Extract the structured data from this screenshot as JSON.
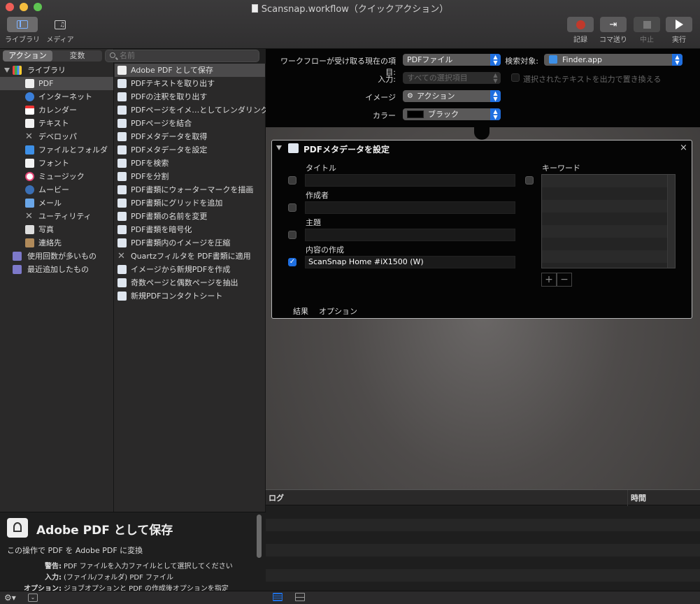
{
  "window": {
    "title": "Scansnap.workflow（クイックアクション）"
  },
  "toolbar": {
    "library_label": "ライブラリ",
    "media_label": "メディア",
    "record_label": "記録",
    "step_label": "コマ送り",
    "stop_label": "中止",
    "run_label": "実行"
  },
  "segments": {
    "actions": "アクション",
    "variables": "変数"
  },
  "search": {
    "placeholder": "名前"
  },
  "library": {
    "root": "ライブラリ",
    "items": [
      {
        "label": "PDF",
        "selected": true
      },
      {
        "label": "インターネット"
      },
      {
        "label": "カレンダー"
      },
      {
        "label": "テキスト"
      },
      {
        "label": "デベロッパ"
      },
      {
        "label": "ファイルとフォルダ"
      },
      {
        "label": "フォント"
      },
      {
        "label": "ミュージック"
      },
      {
        "label": "ムービー"
      },
      {
        "label": "メール"
      },
      {
        "label": "ユーティリティ"
      },
      {
        "label": "写真"
      },
      {
        "label": "連絡先"
      }
    ],
    "smart": [
      "使用回数が多いもの",
      "最近追加したもの"
    ]
  },
  "actions": [
    "Adobe PDF として保存",
    "PDFテキストを取り出す",
    "PDFの注釈を取り出す",
    "PDFページをイメ…としてレンダリング",
    "PDFページを結合",
    "PDFメタデータを取得",
    "PDFメタデータを設定",
    "PDFを検索",
    "PDFを分割",
    "PDF書類にウォーターマークを描画",
    "PDF書類にグリッドを追加",
    "PDF書類の名前を変更",
    "PDF書類を暗号化",
    "PDF書類内のイメージを圧縮",
    "Quartzフィルタを PDF書類に適用",
    "イメージから新規PDFを作成",
    "奇数ページと偶数ページを抽出",
    "新規PDFコンタクトシート"
  ],
  "description": {
    "title": "Adobe PDF として保存",
    "summary": "この操作で PDF を Adobe PDF に変換",
    "warning_key": "警告:",
    "warning_val": "PDF ファイルを入力ファイルとして選択してください",
    "input_key": "入力:",
    "input_val": "(ファイル/フォルダ) PDF ファイル",
    "option_key": "オプション:",
    "option_val": "ジョブオプションと PDF の作成後オプションを指定"
  },
  "header": {
    "receives_label": "ワークフローが受け取る現在の項目:",
    "receives_value": "PDFファイル",
    "search_label": "検索対象:",
    "search_value": "Finder.app",
    "input_label": "入力:",
    "input_value": "すべての選択項目",
    "replace_label": "選択されたテキストを出力で置き換える",
    "image_label": "イメージ",
    "image_value": "アクション",
    "color_label": "カラー",
    "color_value": "ブラック"
  },
  "action_box": {
    "title": "PDFメタデータを設定",
    "title_field": "タイトル",
    "author_field": "作成者",
    "subject_field": "主題",
    "creator_field": "内容の作成",
    "creator_value": "ScanSnap Home #iX1500 (W)",
    "keywords_field": "キーワード",
    "results_tab": "結果",
    "options_tab": "オプション"
  },
  "log": {
    "log_col": "ログ",
    "time_col": "時間"
  },
  "colors": {
    "accent": "#1f6fe0",
    "record": "#c0392b"
  }
}
